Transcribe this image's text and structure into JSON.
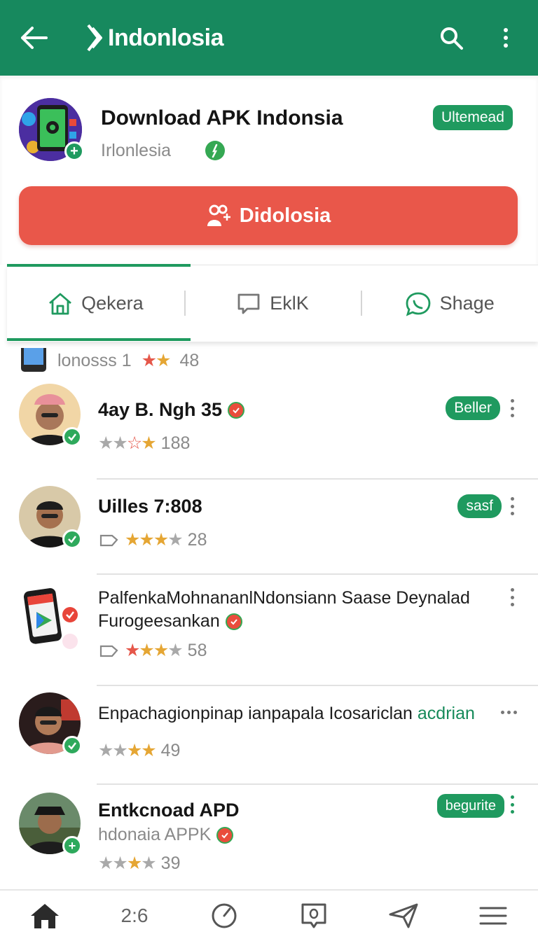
{
  "appbar": {
    "title": "Indonlosia",
    "back_icon": "arrow-left-icon",
    "logo_icon": "brand-logo-icon",
    "search_icon": "search-icon",
    "more_icon": "more-vert-icon",
    "background": "#17895e"
  },
  "app": {
    "title": "Download APK Indonsia",
    "subtitle": "Irlonlesia",
    "badge": "Ultemead",
    "download_label": "Didolosia",
    "accent": "#e9574a"
  },
  "tabs": [
    {
      "label": "Qekera",
      "icon": "home-outline-icon",
      "active": true
    },
    {
      "label": "EklK",
      "icon": "chat-bubble-icon",
      "active": false
    },
    {
      "label": "Shage",
      "icon": "whatsapp-icon",
      "active": false
    }
  ],
  "partial_row": {
    "text": "lonosss 1",
    "rating": "48"
  },
  "reviews": [
    {
      "name": "4ay B. Ngh 35",
      "chip": "Beller",
      "count": "188"
    },
    {
      "name": "Uilles 7:808",
      "chip": "sasf",
      "count": "28"
    },
    {
      "text_line1": "PalfenkaMohnananlNdonsiann Saase Deynalad",
      "text_line2": "Furogeesankan",
      "count": "58"
    },
    {
      "text": "Enpachagionpinap ianpapala Icosariclan",
      "link": "acdrian",
      "count": "49"
    },
    {
      "name": "Entkcnoad APD",
      "subtitle": "hdonaia APPK",
      "chip": "begurite",
      "count": "39"
    }
  ],
  "bottomnav": [
    {
      "icon": "home-filled-icon"
    },
    {
      "label": "2:6"
    },
    {
      "icon": "speedometer-icon"
    },
    {
      "icon": "message-square-icon"
    },
    {
      "icon": "send-icon"
    },
    {
      "icon": "hamburger-menu-icon"
    }
  ]
}
